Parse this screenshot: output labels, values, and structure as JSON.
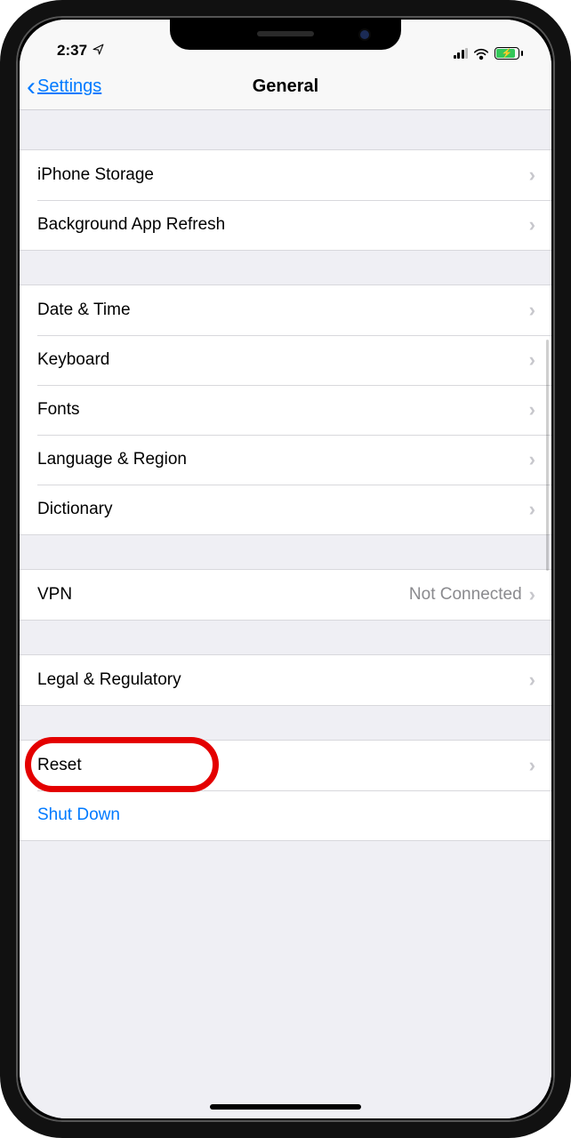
{
  "status_bar": {
    "time": "2:37",
    "location_icon": "➤"
  },
  "nav": {
    "back_label": "Settings",
    "title": "General"
  },
  "groups": [
    {
      "gap_class": "first",
      "cells": [
        {
          "name": "iphone-storage",
          "label": "iPhone Storage",
          "interactable": true,
          "chevron": true
        },
        {
          "name": "background-app-refresh",
          "label": "Background App Refresh",
          "interactable": true,
          "chevron": true
        }
      ]
    },
    {
      "gap_class": "",
      "cells": [
        {
          "name": "date-time",
          "label": "Date & Time",
          "interactable": true,
          "chevron": true
        },
        {
          "name": "keyboard",
          "label": "Keyboard",
          "interactable": true,
          "chevron": true
        },
        {
          "name": "fonts",
          "label": "Fonts",
          "interactable": true,
          "chevron": true
        },
        {
          "name": "language-region",
          "label": "Language & Region",
          "interactable": true,
          "chevron": true
        },
        {
          "name": "dictionary",
          "label": "Dictionary",
          "interactable": true,
          "chevron": true
        }
      ]
    },
    {
      "gap_class": "",
      "cells": [
        {
          "name": "vpn",
          "label": "VPN",
          "detail": "Not Connected",
          "interactable": true,
          "chevron": true
        }
      ]
    },
    {
      "gap_class": "",
      "cells": [
        {
          "name": "legal-regulatory",
          "label": "Legal & Regulatory",
          "interactable": true,
          "chevron": true
        }
      ]
    },
    {
      "gap_class": "",
      "cells": [
        {
          "name": "reset",
          "label": "Reset",
          "interactable": true,
          "chevron": true,
          "highlighted": true
        },
        {
          "name": "shut-down",
          "label": "Shut Down",
          "interactable": true,
          "chevron": false,
          "button": true
        }
      ]
    }
  ],
  "annotation": {
    "highlight_target": "reset"
  }
}
